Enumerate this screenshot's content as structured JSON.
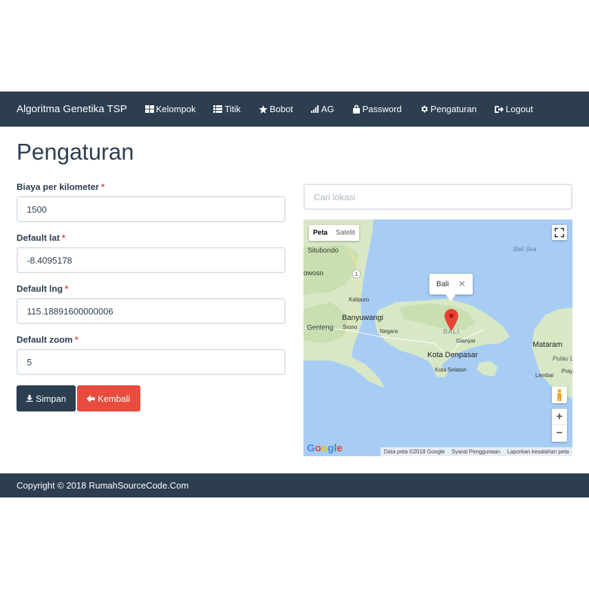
{
  "navbar": {
    "brand": "Algoritma Genetika TSP",
    "items": [
      {
        "label": "Kelompok",
        "icon": "grid-icon"
      },
      {
        "label": "Titik",
        "icon": "list-icon"
      },
      {
        "label": "Bobot",
        "icon": "star-icon"
      },
      {
        "label": "AG",
        "icon": "signal-icon"
      },
      {
        "label": "Password",
        "icon": "lock-icon"
      },
      {
        "label": "Pengaturan",
        "icon": "gear-icon"
      },
      {
        "label": "Logout",
        "icon": "logout-icon"
      }
    ]
  },
  "page": {
    "title": "Pengaturan"
  },
  "form": {
    "required_mark": "*",
    "fields": [
      {
        "label": "Biaya per kilometer",
        "value": "1500"
      },
      {
        "label": "Default lat",
        "value": "-8.4095178"
      },
      {
        "label": "Default lng",
        "value": "115.18891600000006"
      },
      {
        "label": "Default zoom",
        "value": "5"
      }
    ],
    "save_label": "Simpan",
    "back_label": "Kembali"
  },
  "search": {
    "placeholder": "Cari lokasi"
  },
  "map": {
    "type_map": "Peta",
    "type_satellite": "Satelit",
    "infowindow_text": "Bali",
    "infowindow_close": "✕",
    "zoom_in": "+",
    "zoom_out": "−",
    "labels": {
      "situbondo": "Situbondo",
      "bondowoso": "owoso",
      "bali_sea": "Bali Sea",
      "kalipuro": "Kalipuro",
      "banyuwangi": "Banyuwangi",
      "genteng": "Genteng",
      "srono": "Srono",
      "negara": "Negara",
      "bali": "BALI",
      "gianyar": "Gianyar",
      "kota_denpasar": "Kota Denpasar",
      "kuta_selatan": "Kuta Selatan",
      "mataram": "Mataram",
      "pulau_lombok": "Pulau L",
      "lembar": "Lembar",
      "praya": "Pray"
    },
    "road_shield": "1",
    "google": "Google",
    "attribution": [
      "Data peta ©2018 Google",
      "Syarat Penggunaan",
      "Laporkan kesalahan peta"
    ]
  },
  "footer": {
    "copyright": "Copyright © 2018 RumahSourceCode.Com"
  },
  "colors": {
    "primary": "#2c3e50",
    "danger": "#e74c3c",
    "input_border": "#dce4ec",
    "water": "#a8cdf5",
    "land": "#d9e8c8"
  }
}
